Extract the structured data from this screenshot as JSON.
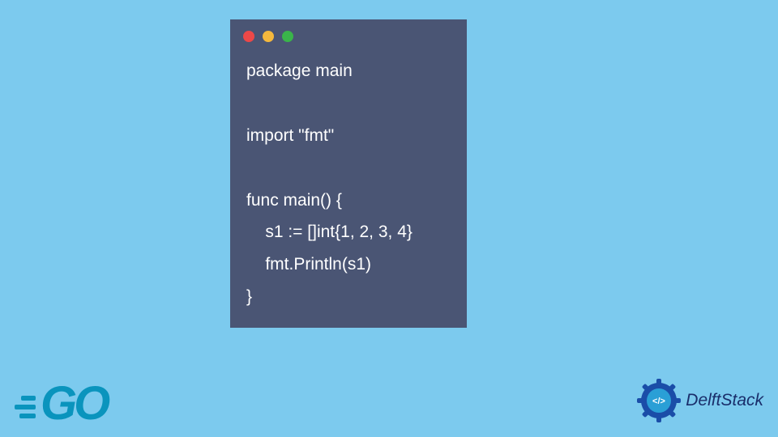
{
  "code": {
    "lines": [
      "package main",
      "",
      "import \"fmt\"",
      "",
      "func main() {",
      "    s1 := []int{1, 2, 3, 4}",
      "    fmt.Println(s1)",
      "}"
    ]
  },
  "logos": {
    "go_text": "GO",
    "delftstack_text": "DelftStack",
    "delftstack_badge_symbol": "</>"
  },
  "colors": {
    "background": "#7ccaee",
    "code_window_bg": "#4a5574",
    "code_text": "#ffffff",
    "go_logo": "#0a94bd",
    "delftstack_text": "#1a2e6b",
    "traffic_red": "#ec4848",
    "traffic_yellow": "#f5b83d",
    "traffic_green": "#3ab54a"
  }
}
